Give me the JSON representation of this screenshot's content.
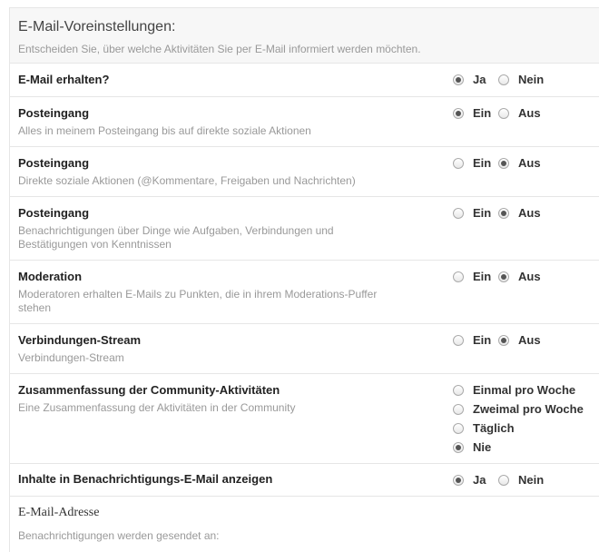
{
  "header": {
    "title": "E-Mail-Voreinstellungen:",
    "subtitle": "Entscheiden Sie, über welche Aktivitäten Sie per E-Mail informiert werden möchten."
  },
  "rows": [
    {
      "title": "E-Mail erhalten?",
      "description": "",
      "options": [
        {
          "label": "Ja",
          "checked": true
        },
        {
          "label": "Nein",
          "checked": false
        }
      ]
    },
    {
      "title": "Posteingang",
      "description": "Alles in meinem Posteingang bis auf direkte soziale Aktionen",
      "options": [
        {
          "label": "Ein",
          "checked": true
        },
        {
          "label": "Aus",
          "checked": false
        }
      ]
    },
    {
      "title": "Posteingang",
      "description": "Direkte soziale Aktionen (@Kommentare, Freigaben und Nachrichten)",
      "options": [
        {
          "label": "Ein",
          "checked": false
        },
        {
          "label": "Aus",
          "checked": true
        }
      ]
    },
    {
      "title": "Posteingang",
      "description": "Benachrichtigungen über Dinge wie Aufgaben, Verbindungen und Bestätigungen von Kenntnissen",
      "options": [
        {
          "label": "Ein",
          "checked": false
        },
        {
          "label": "Aus",
          "checked": true
        }
      ]
    },
    {
      "title": "Moderation",
      "description": "Moderatoren erhalten E-Mails zu Punkten, die in ihrem Moderations-Puffer stehen",
      "options": [
        {
          "label": "Ein",
          "checked": false
        },
        {
          "label": "Aus",
          "checked": true
        }
      ]
    },
    {
      "title": "Verbindungen-Stream",
      "description": "Verbindungen-Stream",
      "options": [
        {
          "label": "Ein",
          "checked": false
        },
        {
          "label": "Aus",
          "checked": true
        }
      ]
    },
    {
      "title": "Zusammenfassung der Community-Aktivitäten",
      "description": "Eine Zusammenfassung der Aktivitäten in der Community",
      "options": [
        {
          "label": "Einmal pro Woche",
          "checked": false
        },
        {
          "label": "Zweimal pro Woche",
          "checked": false
        },
        {
          "label": "Täglich",
          "checked": false
        },
        {
          "label": "Nie",
          "checked": true
        }
      ]
    },
    {
      "title": "Inhalte in Benachrichtigungs-E-Mail anzeigen",
      "description": "",
      "options": [
        {
          "label": "Ja",
          "checked": true
        },
        {
          "label": "Nein",
          "checked": false
        }
      ]
    }
  ],
  "email_section": {
    "title": "E-Mail-Adresse",
    "description": "Benachrichtigungen werden gesendet an:"
  }
}
